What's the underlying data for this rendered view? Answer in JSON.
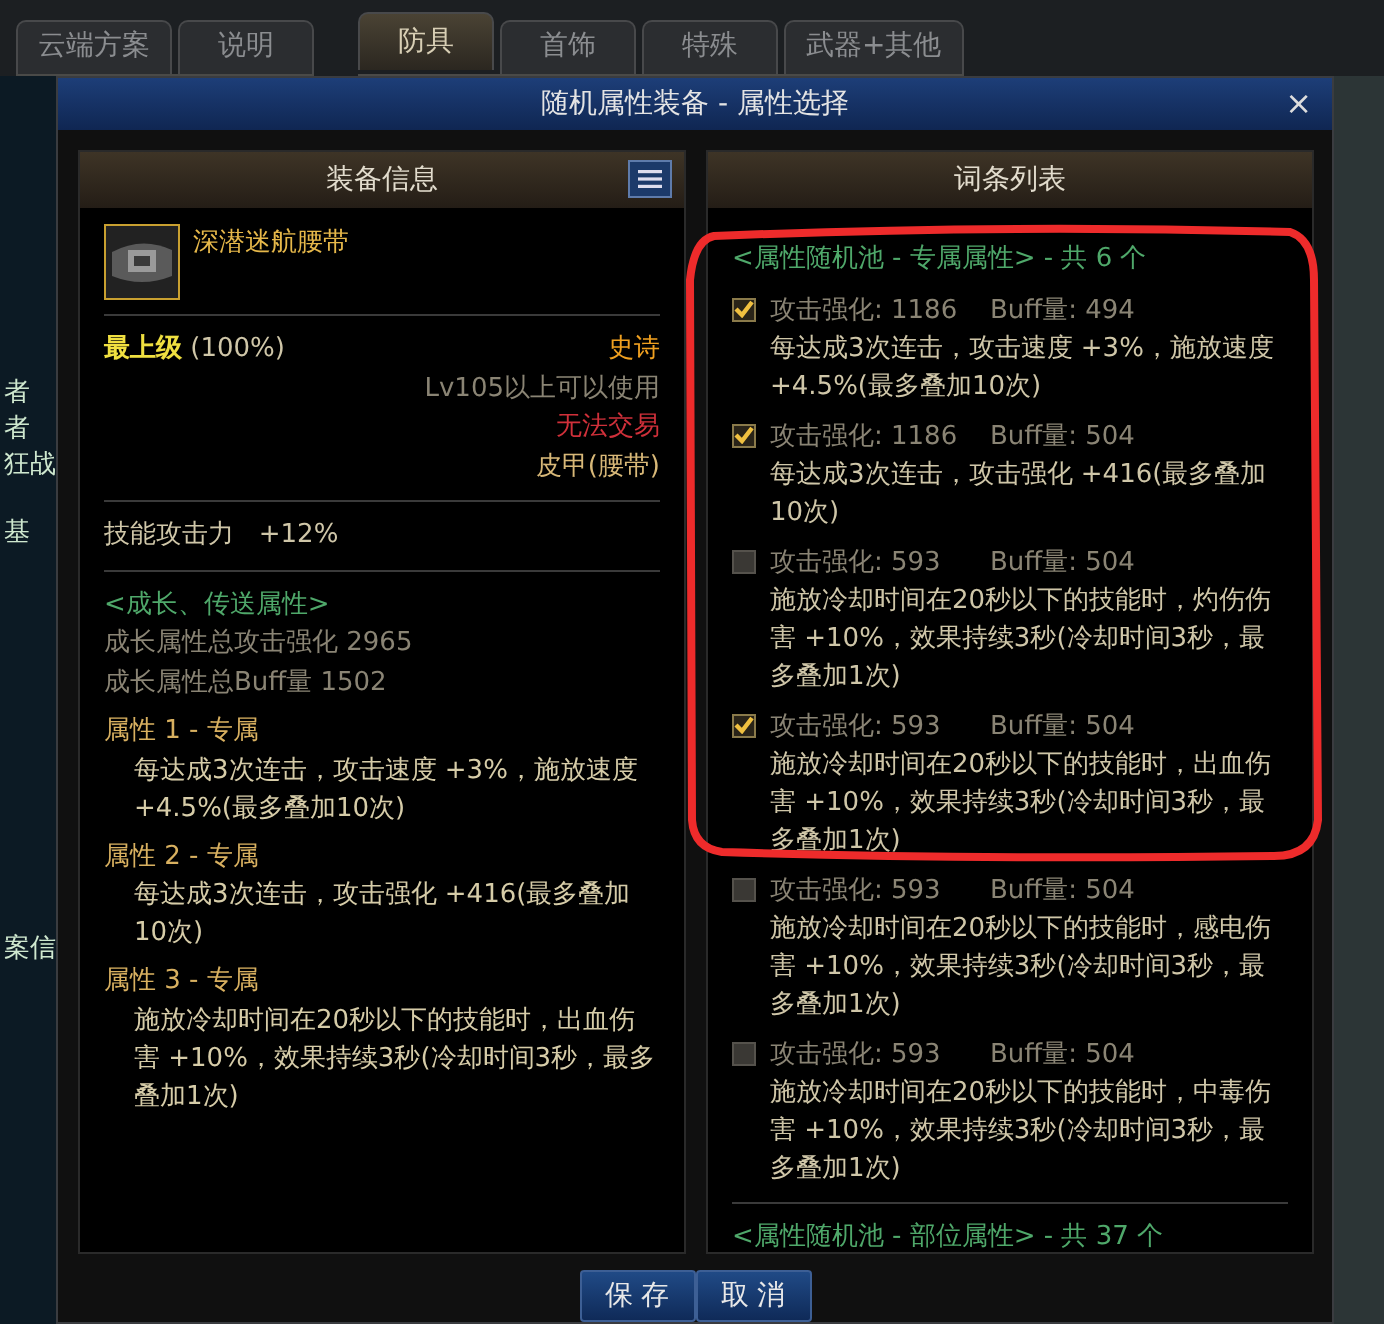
{
  "top_tabs_left": [
    {
      "label": "云端方案",
      "selected": false
    },
    {
      "label": "说明",
      "selected": false
    }
  ],
  "top_tabs_right": [
    {
      "label": "防具",
      "selected": true
    },
    {
      "label": "首饰",
      "selected": false
    },
    {
      "label": "特殊",
      "selected": false
    },
    {
      "label": "武器+其他",
      "selected": false
    }
  ],
  "background_texts": [
    "者",
    "者",
    "狂战",
    "基",
    "案信"
  ],
  "dialog": {
    "title": "随机属性装备 - 属性选择",
    "close": "×"
  },
  "equipment_panel": {
    "header": "装备信息",
    "item_name": "深潜迷航腰带",
    "grade": "最上级",
    "grade_percent": "(100%)",
    "rarity": "史诗",
    "level_req": "Lv105以上可以使用",
    "trade": "无法交易",
    "item_type": "皮甲(腰带)",
    "skill_bonus": "技能攻击力   +12%",
    "growth_heading": "<成长、传送属性>",
    "growth_lines": [
      "成长属性总攻击强化 2965",
      "成长属性总Buff量 1502"
    ],
    "attributes": [
      {
        "title": "属性 1 - 专属",
        "text": "每达成3次连击，攻击速度 +3%，施放速度 +4.5%(最多叠加10次)"
      },
      {
        "title": "属性 2 - 专属",
        "text": "每达成3次连击，攻击强化 +416(最多叠加10次)"
      },
      {
        "title": "属性 3 - 专属",
        "text": "施放冷却时间在20秒以下的技能时，出血伤害 +10%，效果持续3秒(冷却时间3秒，最多叠加1次)"
      }
    ]
  },
  "affix_panel": {
    "header": "词条列表",
    "pool_heading": "<属性随机池 - 专属属性> - 共 6 个",
    "affixes": [
      {
        "checked": true,
        "attack": "攻击强化: 1186",
        "buff": "Buff量: 494",
        "text": "每达成3次连击，攻击速度 +3%，施放速度 +4.5%(最多叠加10次)"
      },
      {
        "checked": true,
        "attack": "攻击强化: 1186",
        "buff": "Buff量: 504",
        "text": "每达成3次连击，攻击强化 +416(最多叠加10次)"
      },
      {
        "checked": false,
        "attack": "攻击强化: 593",
        "buff": "Buff量: 504",
        "text": "施放冷却时间在20秒以下的技能时，灼伤伤害 +10%，效果持续3秒(冷却时间3秒，最多叠加1次)"
      },
      {
        "checked": true,
        "attack": "攻击强化: 593",
        "buff": "Buff量: 504",
        "text": "施放冷却时间在20秒以下的技能时，出血伤害 +10%，效果持续3秒(冷却时间3秒，最多叠加1次)"
      },
      {
        "checked": false,
        "attack": "攻击强化: 593",
        "buff": "Buff量: 504",
        "text": "施放冷却时间在20秒以下的技能时，感电伤害 +10%，效果持续3秒(冷却时间3秒，最多叠加1次)"
      },
      {
        "checked": false,
        "attack": "攻击强化: 593",
        "buff": "Buff量: 504",
        "text": "施放冷却时间在20秒以下的技能时，中毒伤害 +10%，效果持续3秒(冷却时间3秒，最多叠加1次)"
      }
    ],
    "next_heading": "<属性随机池 - 部位属性> - 共 37 个"
  },
  "buttons": [
    "保 存",
    "取 消"
  ]
}
